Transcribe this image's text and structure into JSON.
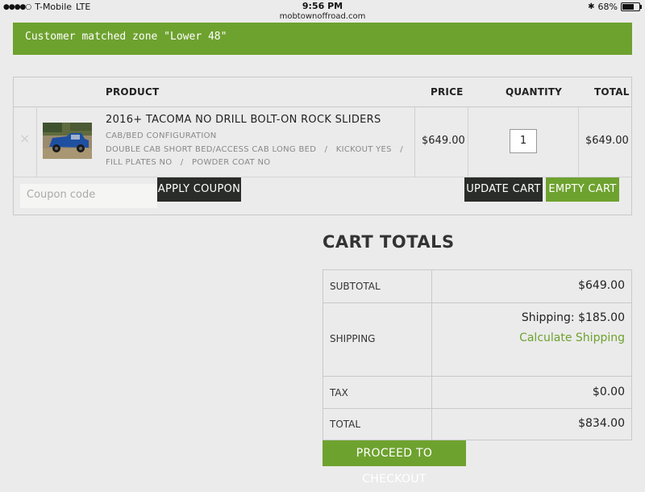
{
  "status_bar": {
    "carrier": "T-Mobile",
    "network": "LTE",
    "time": "9:56 PM",
    "url": "mobtownoffroad.com",
    "battery": "68%",
    "battery_level": 0.68
  },
  "notice": {
    "text": "Customer matched zone \"Lower 48\""
  },
  "cart": {
    "headers": {
      "product": "PRODUCT",
      "price": "PRICE",
      "quantity": "QUANTITY",
      "total": "TOTAL"
    },
    "item": {
      "remove": "×",
      "name": "2016+ TACOMA NO DRILL BOLT-ON ROCK SLIDERS",
      "meta_line1": "CAB/BED CONFIGURATION",
      "meta_line2": "DOUBLE CAB SHORT BED/ACCESS CAB LONG BED   /   KICKOUT YES   /",
      "meta_line3": "FILL PLATES NO   /   POWDER COAT NO",
      "price": "$649.00",
      "quantity": "1",
      "total": "$649.00"
    },
    "coupon_placeholder": "Coupon code",
    "apply_coupon_label": "APPLY COUPON",
    "update_cart_label": "UPDATE CART",
    "empty_cart_label": "EMPTY CART"
  },
  "totals": {
    "title": "CART TOTALS",
    "subtotal_label": "SUBTOTAL",
    "subtotal_value": "$649.00",
    "shipping_label": "SHIPPING",
    "shipping_value": "Shipping: $185.00",
    "calculate_shipping": "Calculate Shipping",
    "tax_label": "TAX",
    "tax_value": "$0.00",
    "total_label": "TOTAL",
    "total_value": "$834.00",
    "checkout_label": "PROCEED TO CHECKOUT"
  },
  "colors": {
    "accent_green": "#6ea22f",
    "dark_button": "#2a2c29",
    "background": "#ebebeb"
  }
}
